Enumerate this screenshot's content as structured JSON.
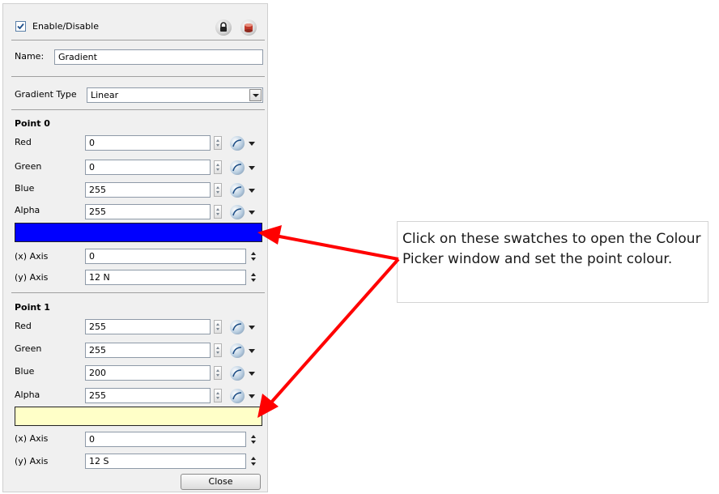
{
  "header": {
    "enable_label": "Enable/Disable",
    "enabled": true,
    "lock_icon": "lock-icon",
    "db_icon": "database-icon"
  },
  "name_row": {
    "label": "Name:",
    "value": "Gradient"
  },
  "gradient_type": {
    "label": "Gradient Type",
    "value": "Linear"
  },
  "point0": {
    "title": "Point 0",
    "fields": [
      {
        "label": "Red",
        "value": "0"
      },
      {
        "label": "Green",
        "value": "0"
      },
      {
        "label": "Blue",
        "value": "255"
      },
      {
        "label": "Alpha",
        "value": "255"
      }
    ],
    "swatch_color": "#0000ff",
    "x_axis": {
      "label": "(x) Axis",
      "value": "0"
    },
    "y_axis": {
      "label": "(y) Axis",
      "value": "12 N"
    }
  },
  "point1": {
    "title": "Point 1",
    "fields": [
      {
        "label": "Red",
        "value": "255"
      },
      {
        "label": "Green",
        "value": "255"
      },
      {
        "label": "Blue",
        "value": "200"
      },
      {
        "label": "Alpha",
        "value": "255"
      }
    ],
    "swatch_color": "#ffffc8",
    "x_axis": {
      "label": "(x) Axis",
      "value": "0"
    },
    "y_axis": {
      "label": "(y) Axis",
      "value": "12 S"
    }
  },
  "close_button": "Close",
  "callout": {
    "text": "Click on these swatches to open the Colour Picker window and set the point colour.",
    "arrow_color": "#ff0000"
  }
}
